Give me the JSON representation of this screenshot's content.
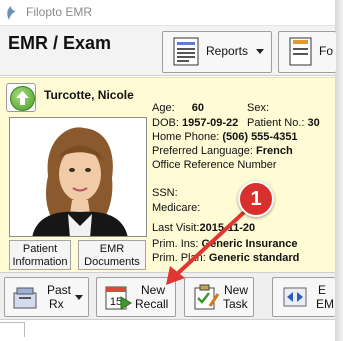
{
  "window": {
    "title": "Filopto EMR"
  },
  "header": {
    "title": "EMR / Exam",
    "reports_label": "Reports",
    "form_label": "Fo"
  },
  "patient": {
    "name": "Turcotte, Nicole",
    "age_label": "Age:",
    "age": "60",
    "sex_label": "Sex:",
    "dob_label": "DOB:",
    "dob": "1957-09-22",
    "patient_no_label": "Patient No.:",
    "patient_no": "30",
    "home_phone_label": "Home Phone:",
    "home_phone": "(506) 555-4351",
    "language_label": "Preferred Language:",
    "language": "French",
    "office_ref_label": "Office Reference Number",
    "ssn_label": "SSN:",
    "medicare_label": "Medicare:",
    "last_visit_label": "Last Visit:",
    "last_visit": "2015-11-20",
    "prim_ins_label": "Prim. Ins:",
    "prim_ins": "Generic Insurance",
    "prim_plan_label": "Prim. Plan:",
    "prim_plan": "Generic standard",
    "info_button": {
      "line1": "Patient",
      "line2": "Information"
    },
    "docs_button": {
      "line1": "EMR",
      "line2": "Documents"
    }
  },
  "toolbar": {
    "past_rx": {
      "line1": "Past",
      "line2": "Rx"
    },
    "new_recall": {
      "line1": "New",
      "line2": "Recall",
      "calendar_number": "15"
    },
    "new_task": {
      "line1": "New",
      "line2": "Task"
    },
    "e_button": {
      "line1": "E",
      "line2": "EM"
    }
  },
  "annotation": {
    "badge": "1",
    "color": "#d9302d"
  },
  "icons": [
    "logo-icon",
    "reports-icon",
    "form-icon",
    "up-arrow-icon",
    "past-rx-icon",
    "dropdown-caret-icon",
    "calendar-icon",
    "task-icon",
    "arrows-icon"
  ]
}
